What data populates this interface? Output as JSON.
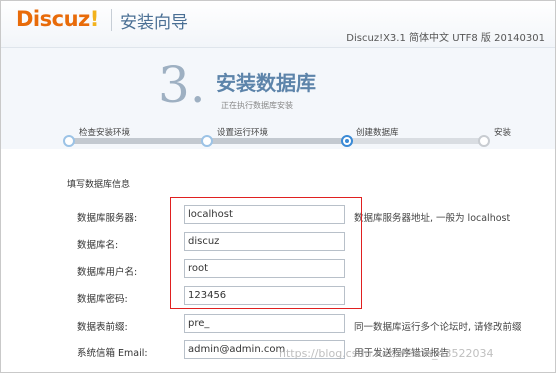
{
  "header": {
    "logo_text": "Discuz",
    "logo_mark": "!",
    "title": "安装向导",
    "version": "Discuz!X3.1 简体中文 UTF8 版 20140301"
  },
  "step": {
    "number": "3.",
    "title": "安装数据库",
    "subtitle": "正在执行数据库安装"
  },
  "progress": {
    "steps": [
      "检查安装环境",
      "设置运行环境",
      "创建数据库",
      "安装"
    ],
    "current_index": 2
  },
  "form": {
    "section_title": "填写数据库信息",
    "rows": [
      {
        "label": "数据库服务器:",
        "value": "localhost",
        "hint": "数据库服务器地址, 一般为 localhost"
      },
      {
        "label": "数据库名:",
        "value": "discuz",
        "hint": ""
      },
      {
        "label": "数据库用户名:",
        "value": "root",
        "hint": ""
      },
      {
        "label": "数据库密码:",
        "value": "123456",
        "hint": ""
      },
      {
        "label": "数据表前缀:",
        "value": "pre_",
        "hint": "同一数据库运行多个论坛时, 请修改前缀"
      },
      {
        "label": "系统信箱 Email:",
        "value": "admin@admin.com",
        "hint": "用于发送程序错误报告"
      }
    ]
  },
  "watermark": "https://blog.csdn.net/weixin_43522034",
  "colors": {
    "logo_orange": "#e86b0a",
    "title_blue": "#4a6f94",
    "step_blue": "#5d84aa",
    "highlight_red": "#e02020"
  }
}
